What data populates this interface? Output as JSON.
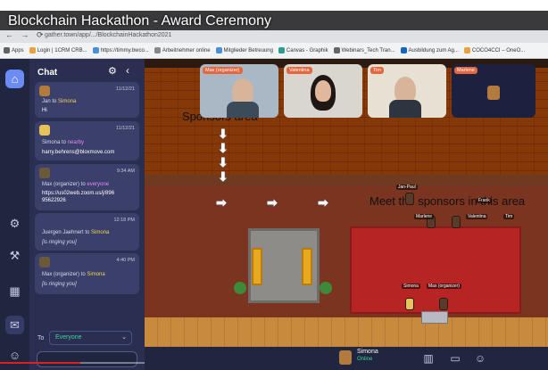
{
  "video": {
    "title": "Blockchain Hackathon - Award Ceremony"
  },
  "browser": {
    "url": "gather.town/app/.../BlockchainHackathon2021",
    "bookmarks": [
      {
        "label": "Apps",
        "color": "#5f6368"
      },
      {
        "label": "Login | 1CRM CRB...",
        "color": "#e6a23c"
      },
      {
        "label": "https://timmy.bwco...",
        "color": "#4a90d9"
      },
      {
        "label": "Arbeitnehmer online",
        "color": "#888888"
      },
      {
        "label": "Mitglieder Betreuung",
        "color": "#4a90d9"
      },
      {
        "label": "Canvas - Graphik",
        "color": "#2a9d8f"
      },
      {
        "label": "Webinars_Tech Tran...",
        "color": "#666666"
      },
      {
        "label": "Ausbildung zum Ag...",
        "color": "#1565c0"
      },
      {
        "label": "COCO4CCI – OneO...",
        "color": "#e6a23c"
      }
    ]
  },
  "sidebar": {
    "icons": [
      "home-icon",
      "gear-icon",
      "hammer-icon",
      "calendar-icon",
      "chat-icon",
      "people-icon"
    ]
  },
  "chat": {
    "title": "Chat",
    "messages": [
      {
        "time": "11/12/21",
        "header_prefix": "Jan to ",
        "to": "Simona",
        "text": "Hi",
        "italic": false
      },
      {
        "time": "11/12/21",
        "header_prefix": "Simona to ",
        "to": "nearby",
        "text": "harry.behrens@bloxmove.com",
        "italic": false
      },
      {
        "time": "9:34 AM",
        "header_prefix": "Max (organizer) to ",
        "to": "everyone",
        "text": "https://us02web.zoom.us/j/896\n95622926",
        "italic": false
      },
      {
        "time": "12:18 PM",
        "header_prefix": "Juergen Jaehnert to ",
        "to": "Simona",
        "text": "[is ringing you]",
        "italic": true
      },
      {
        "time": "4:40 PM",
        "header_prefix": "Max (organizer) to ",
        "to": "Simona",
        "text": "[is ringing you]",
        "italic": true
      }
    ],
    "to_label": "To",
    "to_value": "Everyone"
  },
  "map": {
    "sponsors_label": "Sponsors area",
    "meet_label": "Meet the sponsors in this area",
    "avatar_tags": [
      "Jan-Paul",
      "Frank",
      "Marlene",
      "Valentina",
      "Tim",
      "Simona",
      "Max (organizer)"
    ]
  },
  "video_tiles": [
    {
      "label": "Max (organizer)"
    },
    {
      "label": "Valentina"
    },
    {
      "label": "Tim"
    },
    {
      "label": "Marlene"
    }
  ],
  "user": {
    "name": "Simona",
    "status": "Online"
  },
  "colors": {
    "sidebar_bg": "#202540",
    "chat_bg": "#2a2f52",
    "accent": "#6c8cf5",
    "online": "#3fd19b",
    "stage": "#b62423"
  }
}
